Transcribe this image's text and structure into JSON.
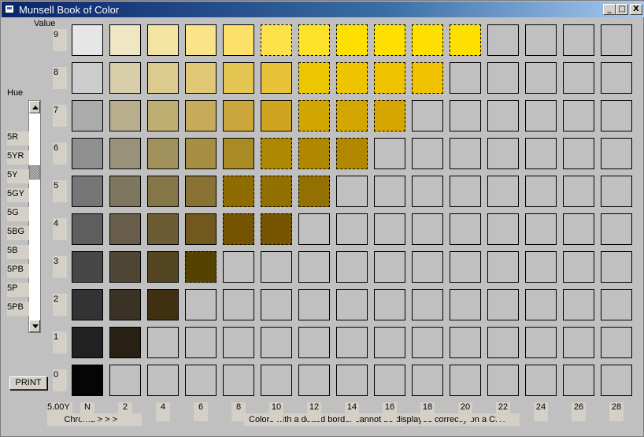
{
  "window": {
    "title": "Munsell Book of Color"
  },
  "titlebar_buttons": {
    "minimize": "_",
    "maximize": "□",
    "close": "X"
  },
  "labels": {
    "hue": "Hue",
    "value": "Value",
    "hue_code": "5.00Y",
    "chroma": "Chroma > > > >",
    "crt_note": "Colors with a dotted border cannot be displayed correctly on a CRT",
    "print": "PRINT"
  },
  "hue_list": [
    "5R",
    "5YR",
    "5Y",
    "5GY",
    "5G",
    "5BG",
    "5B",
    "5PB",
    "5P",
    "5PB"
  ],
  "scrollbar": {
    "position_fraction": 0.27
  },
  "value_labels": [
    "9",
    "8",
    "7",
    "6",
    "5",
    "4",
    "3",
    "2",
    "1",
    "0"
  ],
  "chroma_labels": [
    "N",
    "2",
    "4",
    "6",
    "8",
    "10",
    "12",
    "14",
    "16",
    "18",
    "20",
    "22",
    "24",
    "26",
    "28"
  ],
  "empty_color": "#c0c0c0",
  "chips": [
    [
      {
        "c": "#e6e6e6"
      },
      {
        "c": "#efe6c4"
      },
      {
        "c": "#f4e4a4"
      },
      {
        "c": "#f9e48a"
      },
      {
        "c": "#fde06a"
      },
      {
        "c": "#fde24a",
        "d": true
      },
      {
        "c": "#fee22a",
        "d": true
      },
      {
        "c": "#fde000",
        "d": true
      },
      {
        "c": "#fde000",
        "d": true
      },
      {
        "c": "#fde000",
        "d": true
      },
      {
        "c": "#fde000",
        "d": true
      }
    ],
    [
      {
        "c": "#cdcdcd"
      },
      {
        "c": "#d8ceaa"
      },
      {
        "c": "#dccb8e"
      },
      {
        "c": "#e0c876"
      },
      {
        "c": "#e4c552"
      },
      {
        "c": "#e8c238"
      },
      {
        "c": "#ecc600",
        "d": true
      },
      {
        "c": "#eec400",
        "d": true
      },
      {
        "c": "#efc200",
        "d": true
      },
      {
        "c": "#f0c200",
        "d": true
      }
    ],
    [
      {
        "c": "#ababab"
      },
      {
        "c": "#b8ae8e"
      },
      {
        "c": "#bfae72"
      },
      {
        "c": "#c6ab5a"
      },
      {
        "c": "#cba63c"
      },
      {
        "c": "#cfa41e"
      },
      {
        "c": "#d2a600",
        "d": true
      },
      {
        "c": "#d4a600",
        "d": true
      },
      {
        "c": "#d6a600",
        "d": true
      }
    ],
    [
      {
        "c": "#8f8f8f"
      },
      {
        "c": "#9a917a"
      },
      {
        "c": "#a0915c"
      },
      {
        "c": "#a68e42"
      },
      {
        "c": "#aa8a24"
      },
      {
        "c": "#ae8800",
        "d": true
      },
      {
        "c": "#b08800",
        "d": true
      },
      {
        "c": "#b28800",
        "d": true
      }
    ],
    [
      {
        "c": "#767676"
      },
      {
        "c": "#7f7660"
      },
      {
        "c": "#857648"
      },
      {
        "c": "#8a7234"
      },
      {
        "c": "#8e6c00",
        "d": true
      },
      {
        "c": "#927000",
        "d": true
      },
      {
        "c": "#947000",
        "d": true
      }
    ],
    [
      {
        "c": "#5e5e5e"
      },
      {
        "c": "#675d4a"
      },
      {
        "c": "#6c5c34"
      },
      {
        "c": "#70581e"
      },
      {
        "c": "#745400",
        "d": true
      },
      {
        "c": "#765400",
        "d": true
      }
    ],
    [
      {
        "c": "#474747"
      },
      {
        "c": "#4f4636"
      },
      {
        "c": "#534422"
      },
      {
        "c": "#564200",
        "d": true
      }
    ],
    [
      {
        "c": "#333333"
      },
      {
        "c": "#3a3224"
      },
      {
        "c": "#3e3010"
      }
    ],
    [
      {
        "c": "#212121"
      },
      {
        "c": "#282012"
      }
    ],
    [
      {
        "c": "#050505"
      }
    ]
  ]
}
